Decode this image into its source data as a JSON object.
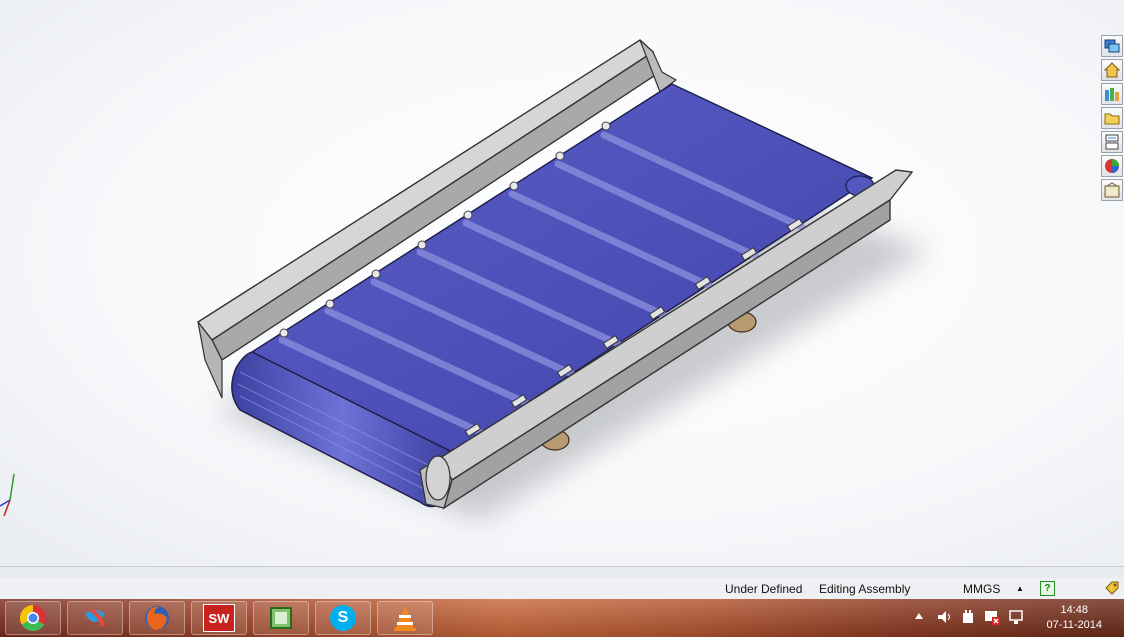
{
  "viewport": {
    "model_name": "conveyor-assembly",
    "colors": {
      "belt": "#4a4fb8",
      "frame": "#c9c9c9",
      "background": "#f5f6f8"
    }
  },
  "task_pane": {
    "buttons": [
      {
        "icon": "resources-icon"
      },
      {
        "icon": "home-icon"
      },
      {
        "icon": "library-icon"
      },
      {
        "icon": "file-explorer-icon"
      },
      {
        "icon": "view-palette-icon"
      },
      {
        "icon": "appearances-icon"
      },
      {
        "icon": "custom-properties-icon"
      }
    ]
  },
  "status_bar": {
    "state": "Under Defined",
    "mode": "Editing Assembly",
    "units": "MMGS",
    "units_arrow": "▲",
    "help": "?"
  },
  "taskbar": {
    "apps": [
      {
        "icon": "chrome-icon"
      },
      {
        "icon": "windows-live-icon"
      },
      {
        "icon": "firefox-icon"
      },
      {
        "icon": "solidworks-icon",
        "label": "SW"
      },
      {
        "icon": "notepad-icon"
      },
      {
        "icon": "skype-icon",
        "label": "S"
      },
      {
        "icon": "vlc-icon"
      }
    ],
    "clock": {
      "time": "14:48",
      "date": "07-11-2014"
    }
  }
}
